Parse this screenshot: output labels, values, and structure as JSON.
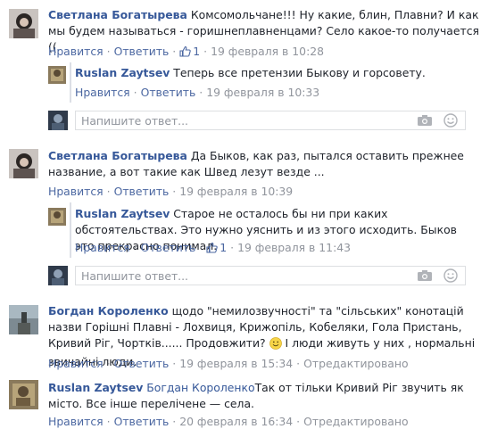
{
  "threads": [
    {
      "author": "Светлана Богатырева",
      "text": "Комсомольчане!!! Ну какие, блин, Плавни? И как мы будем называться - горишнеплавненцами? Село какое-то получается ((",
      "like_label": "Нравится",
      "reply_label": "Ответить",
      "like_count": "1",
      "date": "19 февраля в 10:28",
      "replies": [
        {
          "author": "Ruslan Zaytsev",
          "text": "Теперь все претензии Быкову и горсовету.",
          "like_label": "Нравится",
          "reply_label": "Ответить",
          "date": "19 февраля в 10:33"
        }
      ],
      "input_placeholder": "Напишите ответ..."
    },
    {
      "author": "Светлана Богатырева",
      "text": "Да Быков, как раз, пытался оставить прежнее название, а вот такие как Швед лезут везде ...",
      "like_label": "Нравится",
      "reply_label": "Ответить",
      "date": "19 февраля в 10:39",
      "replies": [
        {
          "author": "Ruslan Zaytsev",
          "text": "Старое не осталось бы ни при каких обстоятельствах. Это нужно уяснить и из этого исходить. Быков это прекрасно понимал.",
          "like_label": "Нравится",
          "reply_label": "Ответить",
          "like_count": "1",
          "date": "19 февраля в 11:43"
        }
      ],
      "input_placeholder": "Напишите ответ..."
    },
    {
      "author": "Богдан Короленко",
      "text_a": "щодо \"немилозвучності\" та \"сільських\" конотацій назви Горішні Плавні - Лохвиця, Крижопіль, Кобеляки, Гола Пристань, Кривий Ріг, Чортків...... Продовжити?",
      "text_b": "І люди живуть у них , нормальні звичайні люди.",
      "like_label": "Нравится",
      "reply_label": "Ответить",
      "date": "19 февраля в 15:34",
      "edited": "Отредактировано"
    },
    {
      "author": "Ruslan Zaytsev",
      "mention": "Богдан Короленко",
      "text": "Так от тільки Кривий Ріг звучить як місто. Все інше перелічене — села.",
      "like_label": "Нравится",
      "reply_label": "Ответить",
      "date": "20 февраля в 16:34",
      "edited": "Отредактировано"
    }
  ],
  "colors": {
    "link": "#365899",
    "meta": "#90949c",
    "border": "#dddfe2"
  },
  "icons": [
    "thumbs-up-icon",
    "camera-icon",
    "smiley-icon",
    "emoji-icon"
  ]
}
